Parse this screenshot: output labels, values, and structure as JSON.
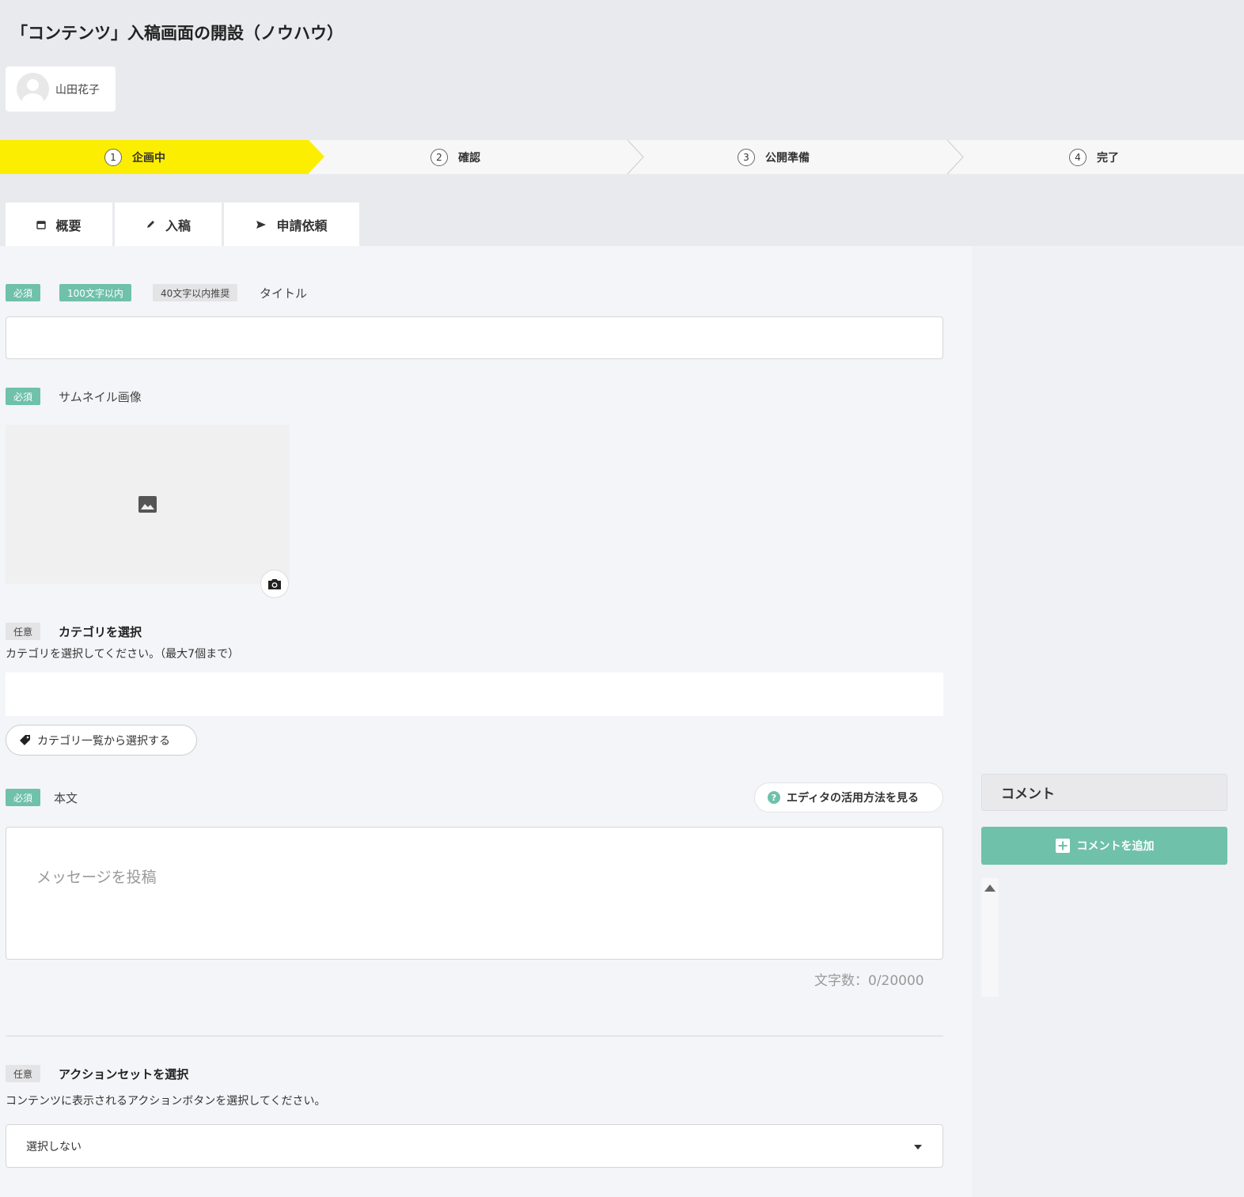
{
  "page": {
    "title": "「コンテンツ」入稿画面の開設（ノウハウ）"
  },
  "user": {
    "name": "山田花子",
    "avatar_icon": "user-avatar-icon"
  },
  "steps": [
    {
      "number": "1",
      "label": "企画中",
      "active": true
    },
    {
      "number": "2",
      "label": "確認",
      "active": false
    },
    {
      "number": "3",
      "label": "公開準備",
      "active": false
    },
    {
      "number": "4",
      "label": "完了",
      "active": false
    }
  ],
  "tabs": [
    {
      "icon": "calendar-icon",
      "label": "概要"
    },
    {
      "icon": "pencil-icon",
      "label": "入稿"
    },
    {
      "icon": "send-icon",
      "label": "申請依頼"
    }
  ],
  "form": {
    "title_field": {
      "badges": {
        "required": "必須",
        "max": "100文字以内",
        "recommended": "40文字以内推奨"
      },
      "label": "タイトル",
      "value": ""
    },
    "thumbnail": {
      "badge": "必須",
      "label": "サムネイル画像",
      "placeholder_icon": "image-icon",
      "upload_icon": "camera-icon"
    },
    "category": {
      "badge": "任意",
      "label": "カテゴリを選択",
      "description": "カテゴリを選択してください。（最大7個まで）",
      "value": "",
      "button_label": "カテゴリ一覧から選択する",
      "button_icon": "tag-icon"
    },
    "body": {
      "badge": "必須",
      "label": "本文",
      "help_label": "エディタの活用方法を見る",
      "help_icon": "question-icon",
      "placeholder": "メッセージを投稿",
      "char_count": "文字数：0/20000"
    },
    "action_set": {
      "badge": "任意",
      "label": "アクションセットを選択",
      "description": "コンテンツに表示されるアクションボタンを選択してください。",
      "selected": "選択しない"
    }
  },
  "comments": {
    "title": "コメント",
    "add_label": "コメントを追加",
    "add_icon": "plus-box-icon"
  },
  "colors": {
    "active_step": "#fcee00",
    "accent": "#6fc1a9",
    "background": "#e9eaee"
  }
}
